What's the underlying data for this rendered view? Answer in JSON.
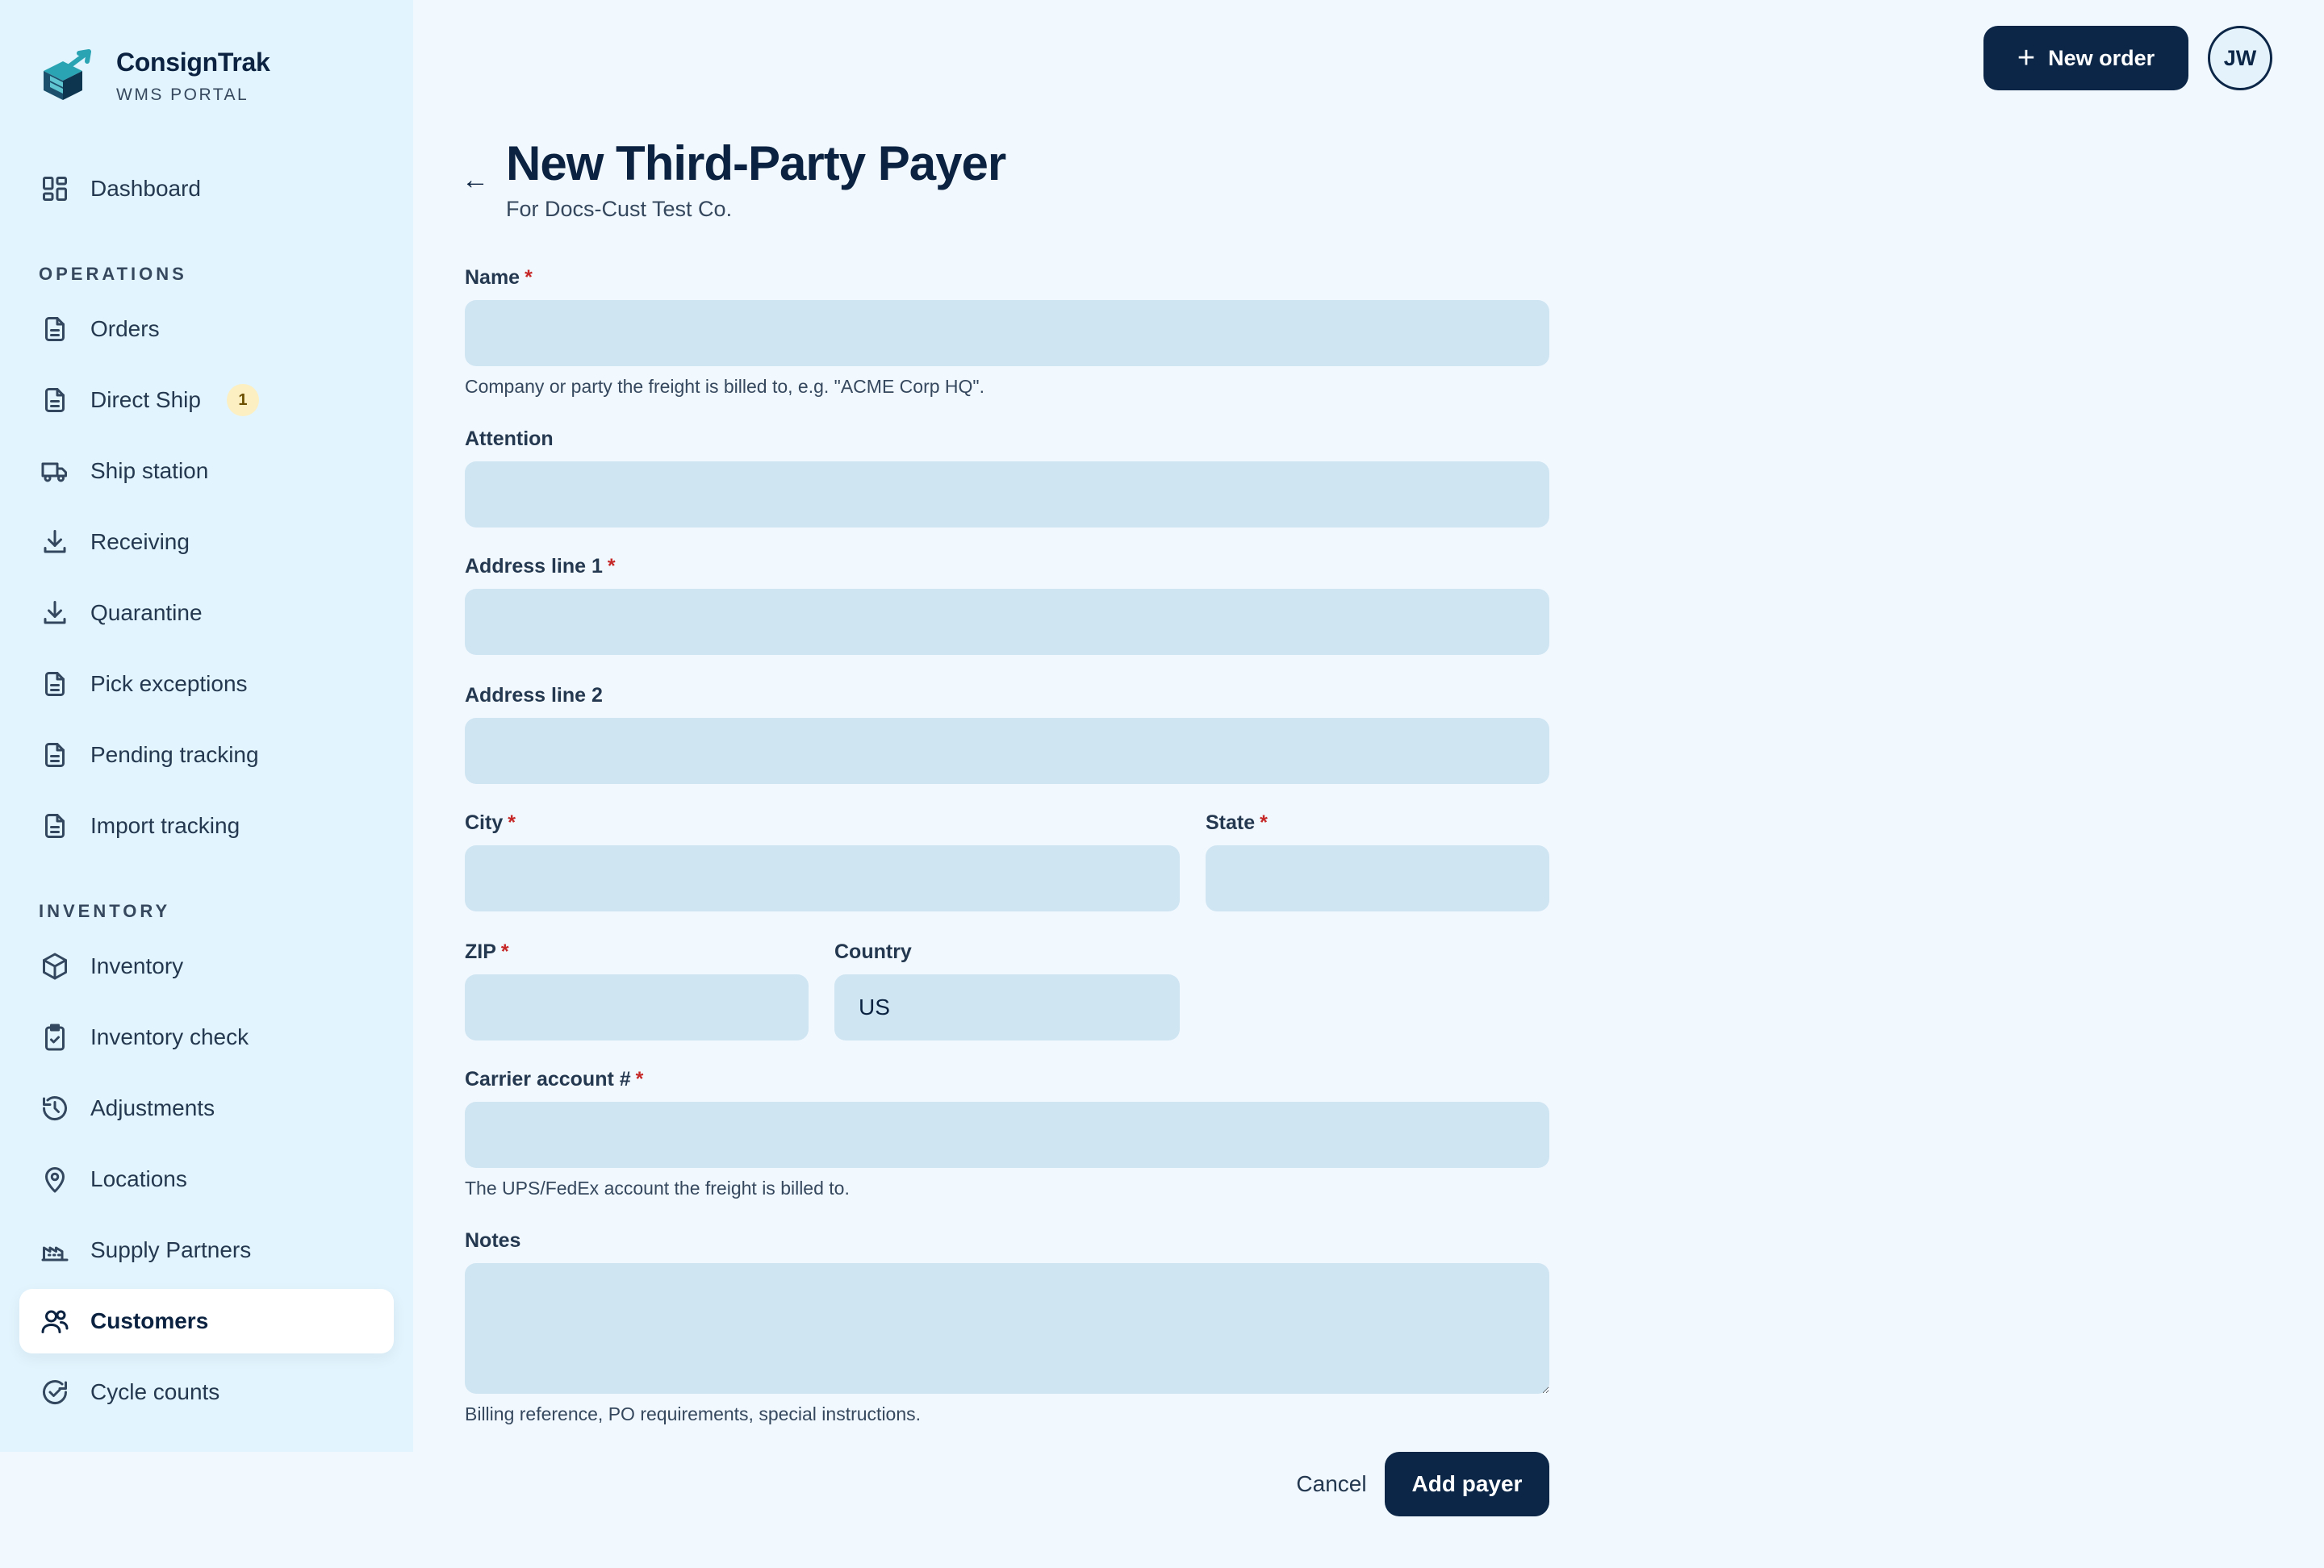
{
  "brand": {
    "name": "ConsignTrak",
    "subtitle": "WMS PORTAL"
  },
  "sidebar": {
    "dashboard": {
      "label": "Dashboard",
      "icon": "dashboard-icon"
    },
    "sections": [
      {
        "title": "OPERATIONS",
        "items": [
          {
            "label": "Orders",
            "icon": "document-icon"
          },
          {
            "label": "Direct Ship",
            "icon": "document-icon",
            "badge": "1"
          },
          {
            "label": "Ship station",
            "icon": "truck-icon"
          },
          {
            "label": "Receiving",
            "icon": "download-icon"
          },
          {
            "label": "Quarantine",
            "icon": "download-icon"
          },
          {
            "label": "Pick exceptions",
            "icon": "document-icon"
          },
          {
            "label": "Pending tracking",
            "icon": "document-icon"
          },
          {
            "label": "Import tracking",
            "icon": "document-icon"
          }
        ]
      },
      {
        "title": "INVENTORY",
        "items": [
          {
            "label": "Inventory",
            "icon": "box-icon"
          },
          {
            "label": "Inventory check",
            "icon": "clipboard-check-icon"
          },
          {
            "label": "Adjustments",
            "icon": "history-icon"
          },
          {
            "label": "Locations",
            "icon": "map-pin-icon"
          },
          {
            "label": "Supply Partners",
            "icon": "factory-icon"
          },
          {
            "label": "Customers",
            "icon": "users-icon",
            "active": true
          },
          {
            "label": "Cycle counts",
            "icon": "refresh-check-icon"
          }
        ]
      }
    ]
  },
  "topbar": {
    "new_order_label": "New order",
    "avatar_initials": "JW"
  },
  "header": {
    "back_icon": "arrow-left-icon",
    "title": "New Third-Party Payer",
    "subtitle": "For Docs-Cust Test Co."
  },
  "form": {
    "name": {
      "label": "Name",
      "required": true,
      "value": "",
      "hint": "Company or party the freight is billed to, e.g. \"ACME Corp HQ\"."
    },
    "attention": {
      "label": "Attention",
      "value": ""
    },
    "address1": {
      "label": "Address line 1",
      "required": true,
      "value": ""
    },
    "address2": {
      "label": "Address line 2",
      "value": ""
    },
    "city": {
      "label": "City",
      "required": true,
      "value": ""
    },
    "state": {
      "label": "State",
      "required": true,
      "value": ""
    },
    "zip": {
      "label": "ZIP",
      "required": true,
      "value": ""
    },
    "country": {
      "label": "Country",
      "value": "US"
    },
    "carrier_account": {
      "label": "Carrier account #",
      "required": true,
      "value": "",
      "hint": "The UPS/FedEx account the freight is billed to."
    },
    "notes": {
      "label": "Notes",
      "value": "",
      "hint": "Billing reference, PO requirements, special instructions."
    },
    "required_marker": "*",
    "cancel_label": "Cancel",
    "submit_label": "Add payer"
  },
  "colors": {
    "primary": "#0b2647",
    "sidebar_bg": "#e2f4fd",
    "page_bg": "#f1f8fe",
    "input_bg": "#cfe5f2",
    "required": "#c62828",
    "badge_bg": "#fcefc2",
    "logo_teal": "#2aa3b3"
  }
}
